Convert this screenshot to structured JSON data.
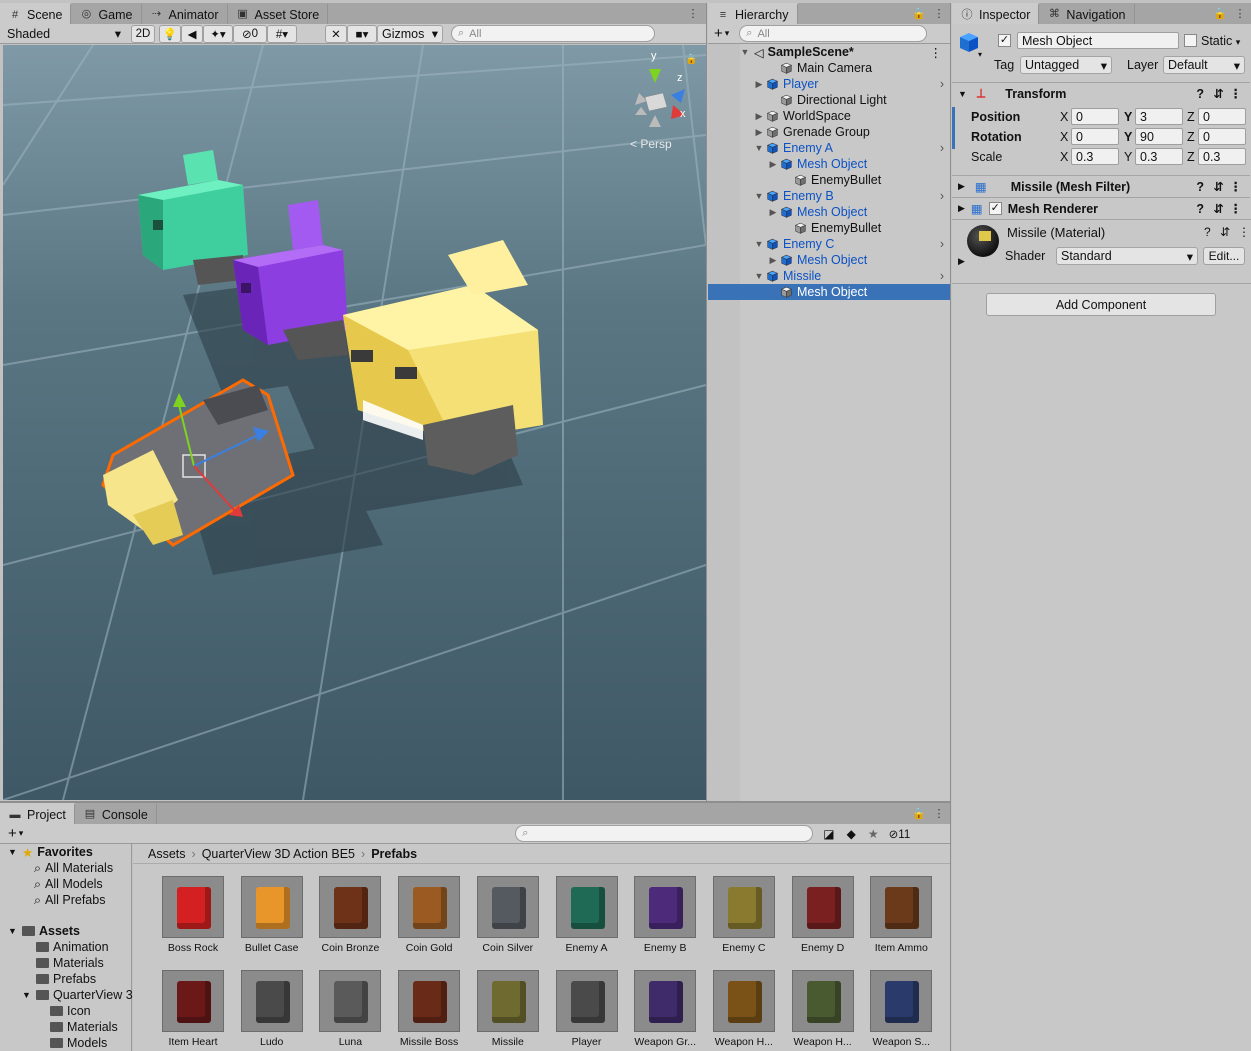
{
  "scene_panel": {
    "tabs": [
      {
        "label": "Scene",
        "icon": "grid-icon"
      },
      {
        "label": "Game",
        "icon": "gamepad-icon"
      },
      {
        "label": "Animator",
        "icon": "animator-icon"
      },
      {
        "label": "Asset Store",
        "icon": "bag-icon"
      }
    ],
    "shading_mode": "Shaded",
    "mode_2d": "2D",
    "hidden_count": "0",
    "gizmos": "Gizmos",
    "search_placeholder": "All",
    "persp_label": "Persp",
    "axis_labels": {
      "y": "y",
      "z": "z",
      "x": "x"
    }
  },
  "hierarchy": {
    "tab": "Hierarchy",
    "search_placeholder": "All",
    "scene_name": "SampleScene*",
    "items": [
      {
        "label": "Main Camera",
        "prefab": false,
        "expand": "none"
      },
      {
        "label": "Player",
        "prefab": true,
        "expand": "collapsed"
      },
      {
        "label": "Directional Light",
        "prefab": false,
        "expand": "none"
      },
      {
        "label": "WorldSpace",
        "prefab": false,
        "expand": "collapsed"
      },
      {
        "label": "Grenade Group",
        "prefab": false,
        "expand": "collapsed"
      },
      {
        "label": "Enemy A",
        "prefab": true,
        "expand": "expanded"
      },
      {
        "label": "Mesh Object",
        "prefab": true,
        "expand": "collapsed"
      },
      {
        "label": "EnemyBullet",
        "prefab": false,
        "expand": "none"
      },
      {
        "label": "Enemy B",
        "prefab": true,
        "expand": "expanded"
      },
      {
        "label": "Mesh Object",
        "prefab": true,
        "expand": "collapsed"
      },
      {
        "label": "EnemyBullet",
        "prefab": false,
        "expand": "none"
      },
      {
        "label": "Enemy C",
        "prefab": true,
        "expand": "expanded"
      },
      {
        "label": "Mesh Object",
        "prefab": true,
        "expand": "collapsed"
      },
      {
        "label": "Missile",
        "prefab": true,
        "expand": "expanded"
      },
      {
        "label": "Mesh Object",
        "prefab": false,
        "expand": "none",
        "selected": true
      }
    ]
  },
  "inspector": {
    "tabs": [
      "Inspector",
      "Navigation"
    ],
    "object_name": "Mesh Object",
    "static_label": "Static",
    "tag_label": "Tag",
    "tag_value": "Untagged",
    "layer_label": "Layer",
    "layer_value": "Default",
    "transform": {
      "title": "Transform",
      "position": {
        "label": "Position",
        "x": "0",
        "y": "3",
        "z": "0"
      },
      "rotation": {
        "label": "Rotation",
        "x": "0",
        "y": "90",
        "z": "0"
      },
      "scale": {
        "label": "Scale",
        "x": "0.3",
        "y": "0.3",
        "z": "0.3"
      },
      "axis": {
        "x": "X",
        "y": "Y",
        "z": "Z"
      }
    },
    "mesh_filter": "Missile (Mesh Filter)",
    "mesh_renderer": "Mesh Renderer",
    "material_name": "Missile (Material)",
    "shader_label": "Shader",
    "shader_value": "Standard",
    "edit_label": "Edit...",
    "add_component": "Add Component"
  },
  "project": {
    "tabs": [
      "Project",
      "Console"
    ],
    "hidden_count": "11",
    "breadcrumb": [
      "Assets",
      "QuarterView 3D Action BE5",
      "Prefabs"
    ],
    "favorites_label": "Favorites",
    "favorites": [
      "All Materials",
      "All Models",
      "All Prefabs"
    ],
    "assets_label": "Assets",
    "folders": [
      "Animation",
      "Materials",
      "Prefabs"
    ],
    "quarterview": "QuarterView 3",
    "subfolders": [
      "Icon",
      "Materials",
      "Models"
    ],
    "items_row1": [
      {
        "name": "Boss Rock",
        "color": "#d42020"
      },
      {
        "name": "Bullet Case",
        "color": "#e8962a"
      },
      {
        "name": "Coin Bronze",
        "color": "#6e3218"
      },
      {
        "name": "Coin Gold",
        "color": "#9a5a22"
      },
      {
        "name": "Coin Silver",
        "color": "#555a60"
      },
      {
        "name": "Enemy A",
        "color": "#1f6a55"
      },
      {
        "name": "Enemy B",
        "color": "#4d2a7a"
      },
      {
        "name": "Enemy C",
        "color": "#8a7a30"
      },
      {
        "name": "Enemy D",
        "color": "#7a2020"
      },
      {
        "name": "Item Ammo",
        "color": "#6a3a1a"
      }
    ],
    "items_row2": [
      {
        "name": "Item Heart",
        "color": "#6a1818"
      },
      {
        "name": "Ludo",
        "color": "#4a4a4a"
      },
      {
        "name": "Luna",
        "color": "#5a5a5a"
      },
      {
        "name": "Missile Boss",
        "color": "#6a2a18"
      },
      {
        "name": "Missile",
        "color": "#6e6a30"
      },
      {
        "name": "Player",
        "color": "#4a4a4a"
      },
      {
        "name": "Weapon Gr...",
        "color": "#3f2a6a"
      },
      {
        "name": "Weapon H...",
        "color": "#7a5218"
      },
      {
        "name": "Weapon H...",
        "color": "#4a5a30"
      },
      {
        "name": "Weapon S...",
        "color": "#2a3a6a"
      }
    ]
  },
  "colors": {
    "accent_selection": "#3a72b8",
    "prefab_blue": "#0b52c4",
    "teal": "#3fcf9e",
    "purple": "#8c3ee0",
    "yellow": "#f5e075",
    "missile_outline": "#ff6a00"
  }
}
